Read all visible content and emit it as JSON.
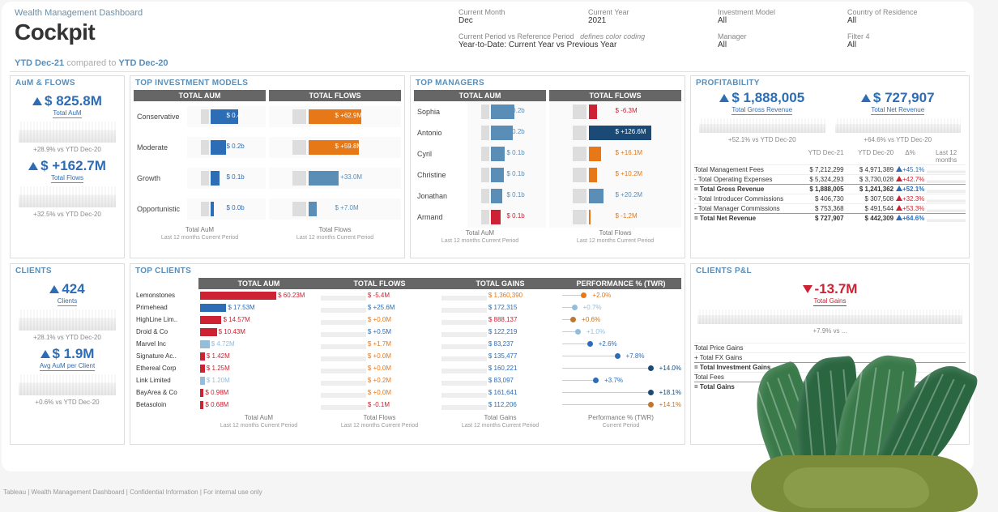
{
  "header": {
    "subtitle": "Wealth Management Dashboard",
    "title": "Cockpit"
  },
  "filters": {
    "month_lbl": "Current Month",
    "month": "Dec",
    "year_lbl": "Current Year",
    "year": "2021",
    "model_lbl": "Investment Model",
    "model": "All",
    "country_lbl": "Country of Residence",
    "country": "All",
    "period_lbl": "Current Period vs Reference Period",
    "period_note": "defines color coding",
    "period_val": "Year-to-Date: Current Year vs Previous Year",
    "manager_lbl": "Manager",
    "manager": "All",
    "filter4_lbl": "Filter 4",
    "filter4": "All"
  },
  "period_bar": {
    "p1": "YTD Dec-21",
    "mid": " compared to ",
    "p2": "YTD Dec-20"
  },
  "kpi_aum": {
    "hdr": "AuM & FLOWS",
    "total_aum": "$ 825.8M",
    "total_aum_lbl": "Total AuM",
    "aum_comp": "+28.9% vs YTD Dec-20",
    "flows": "$ +162.7M",
    "flows_lbl": "Total Flows",
    "flows_comp": "+32.5% vs YTD Dec-20"
  },
  "kpi_clients": {
    "hdr": "CLIENTS",
    "count": "424",
    "count_lbl": "Clients",
    "count_comp": "+28.1% vs YTD Dec-20",
    "avg": "$ 1.9M",
    "avg_lbl": "Avg AuM per Client",
    "avg_comp": "+0.6% vs YTD Dec-20"
  },
  "inv_models": {
    "hdr": "TOP INVESTMENT MODELS",
    "col1": "TOTAL AUM",
    "col2": "TOTAL FLOWS",
    "rows": [
      {
        "name": "Conservative",
        "aum": "$ 0.4b",
        "flow": "$ +62.9M",
        "aum_w": 70,
        "flow_w": 80,
        "fc": "#e67817"
      },
      {
        "name": "Moderate",
        "aum": "$ 0.2b",
        "flow": "$ +59.8M",
        "aum_w": 40,
        "flow_w": 76,
        "fc": "#e67817"
      },
      {
        "name": "Growth",
        "aum": "$ 0.1b",
        "flow": "$ +33.0M",
        "aum_w": 22,
        "flow_w": 45,
        "fc": "#5a8eb7"
      },
      {
        "name": "Opportunistic",
        "aum": "$ 0.0b",
        "flow": "$ +7.0M",
        "aum_w": 8,
        "flow_w": 12,
        "fc": "#5a8eb7"
      }
    ],
    "foot1": "Total AuM",
    "foot2": "Total Flows",
    "sub": "Last 12 months Current Period"
  },
  "managers": {
    "hdr": "TOP MANAGERS",
    "col1": "TOTAL AUM",
    "col2": "TOTAL FLOWS",
    "rows": [
      {
        "name": "Sophia",
        "aum": "$ 0.2b",
        "flow": "$ -6.3M",
        "aum_w": 60,
        "flow_w": -12,
        "fc": "#c23"
      },
      {
        "name": "Antonio",
        "aum": "$ 0.2b",
        "flow": "$ +126.6M",
        "aum_w": 55,
        "flow_w": 95,
        "fc": "#1a4a75"
      },
      {
        "name": "Cyril",
        "aum": "$ 0.1b",
        "flow": "$ +16.1M",
        "aum_w": 35,
        "flow_w": 18,
        "fc": "#e67817"
      },
      {
        "name": "Christine",
        "aum": "$ 0.1b",
        "flow": "$ +10.2M",
        "aum_w": 32,
        "flow_w": 12,
        "fc": "#e67817"
      },
      {
        "name": "Jonathan",
        "aum": "$ 0.1b",
        "flow": "$ +20.2M",
        "aum_w": 28,
        "flow_w": 22,
        "fc": "#5a8eb7"
      },
      {
        "name": "Armand",
        "aum": "$ 0.1b",
        "flow": "$ -1.2M",
        "aum_w": 25,
        "flow_w": -3,
        "fc": "#e67817",
        "ac": "#c23"
      }
    ],
    "foot1": "Total AuM",
    "foot2": "Total Flows",
    "sub": "Last 12 months   Current Period"
  },
  "profit": {
    "hdr": "PROFITABILITY",
    "gross": "$ 1,888,005",
    "gross_lbl": "Total Gross Revenue",
    "gross_comp": "+52.1% vs YTD Dec-20",
    "net": "$ 727,907",
    "net_lbl": "Total Net Revenue",
    "net_comp": "+64.6% vs YTD Dec-20",
    "th": {
      "c1": "",
      "c2": "YTD Dec-21",
      "c3": "YTD Dec-20",
      "c4": "Δ%",
      "c5": "Last 12 months"
    },
    "rows": [
      {
        "l": "  Total Management Fees",
        "v1": "$ 7,212,299",
        "v2": "$ 4,971,389",
        "d": "+45.1%",
        "dc": "blue"
      },
      {
        "l": "- Total Operating Expenses",
        "v1": "$ 5,324,293",
        "v2": "$ 3,730,028",
        "d": "+42.7%",
        "dc": "red"
      },
      {
        "l": "= Total Gross Revenue",
        "v1": "$ 1,888,005",
        "v2": "$ 1,241,362",
        "d": "+52.1%",
        "dc": "blue",
        "b": 1
      },
      {
        "l": "- Total Introducer Commissions",
        "v1": "$ 406,730",
        "v2": "$ 307,508",
        "d": "+32.3%",
        "dc": "red"
      },
      {
        "l": "- Total Manager Commissions",
        "v1": "$ 753,368",
        "v2": "$ 491,544",
        "d": "+53.3%",
        "dc": "red"
      },
      {
        "l": "= Total Net Revenue",
        "v1": "$ 727,907",
        "v2": "$ 442,309",
        "d": "+64.6%",
        "dc": "blue",
        "b": 1
      }
    ]
  },
  "clients": {
    "hdr": "TOP CLIENTS",
    "cols": {
      "c1": "TOTAL AUM",
      "c2": "TOTAL FLOWS",
      "c3": "TOTAL GAINS",
      "c4": "PERFORMANCE % (TWR)"
    },
    "rows": [
      {
        "n": "Lemonstones",
        "a": "$ 60.23M",
        "ac": "#c23",
        "aw": 64,
        "f": "$ -5.4M",
        "fc": "#c23",
        "g": "$ 1,360,390",
        "gc": "#e67817",
        "p": "+2.0%",
        "pc": "#e67817",
        "pp": 20
      },
      {
        "n": "Primehead",
        "a": "$ 17.53M",
        "ac": "#2d6db5",
        "aw": 22,
        "f": "$ +25.6M",
        "fc": "#2d6db5",
        "g": "$ 172,315",
        "gc": "#2d6db5",
        "p": "+0.7%",
        "pc": "#94bdd9",
        "pp": 12
      },
      {
        "n": "HighLine Lim..",
        "a": "$ 14.57M",
        "ac": "#c23",
        "aw": 18,
        "f": "$ +0.0M",
        "fc": "#e67817",
        "g": "$ 888,137",
        "gc": "#c23",
        "p": "+0.6%",
        "pc": "#b73",
        "pp": 11
      },
      {
        "n": "Droid & Co",
        "a": "$ 10.43M",
        "ac": "#c23",
        "aw": 14,
        "f": "$ +0.5M",
        "fc": "#2d6db5",
        "g": "$ 122,219",
        "gc": "#2d6db5",
        "p": "+1.0%",
        "pc": "#94bdd9",
        "pp": 15
      },
      {
        "n": "Marvel Inc",
        "a": "$ 4.72M",
        "ac": "#94bdd9",
        "aw": 8,
        "f": "$ +1.7M",
        "fc": "#e67817",
        "g": "$ 83,237",
        "gc": "#2d6db5",
        "p": "+2.6%",
        "pc": "#2d6db5",
        "pp": 25
      },
      {
        "n": "Signature Ac..",
        "a": "$ 1.42M",
        "ac": "#c23",
        "aw": 4,
        "f": "$ +0.0M",
        "fc": "#e67817",
        "g": "$ 135,477",
        "gc": "#2d6db5",
        "p": "+7.8%",
        "pc": "#2d6db5",
        "pp": 48
      },
      {
        "n": "Ethereal Corp",
        "a": "$ 1.25M",
        "ac": "#c23",
        "aw": 4,
        "f": "$ +0.0M",
        "fc": "#e67817",
        "g": "$ 160,221",
        "gc": "#2d6db5",
        "p": "+14.0%",
        "pc": "#1a4a75",
        "pp": 78
      },
      {
        "n": "Link Limited",
        "a": "$ 1.20M",
        "ac": "#94bdd9",
        "aw": 4,
        "f": "$ +0.2M",
        "fc": "#e67817",
        "g": "$ 83,097",
        "gc": "#2d6db5",
        "p": "+3.7%",
        "pc": "#2d6db5",
        "pp": 30
      },
      {
        "n": "BayArea & Co",
        "a": "$ 0.98M",
        "ac": "#c23",
        "aw": 3,
        "f": "$ +0.0M",
        "fc": "#e67817",
        "g": "$ 161,641",
        "gc": "#2d6db5",
        "p": "+18.1%",
        "pc": "#1a4a75",
        "pp": 88
      },
      {
        "n": "Betasoloin",
        "a": "$ 0.68M",
        "ac": "#c23",
        "aw": 3,
        "f": "$ -0.1M",
        "fc": "#c23",
        "g": "$ 112,206",
        "gc": "#2d6db5",
        "p": "+14.1%",
        "pc": "#b73",
        "pp": 79
      }
    ],
    "foots": {
      "f1": "Total AuM",
      "f2": "Total Flows",
      "f3": "Total Gains",
      "f4": "Performance % (TWR)"
    },
    "sub": "Last 12 months Current Period"
  },
  "pnl": {
    "hdr": "CLIENTS P&L",
    "gain": "-13.7M",
    "gain_lbl": "Total Gains",
    "gain_comp": "+7.9% vs ...",
    "rows": [
      {
        "l": "  Total Price Gains"
      },
      {
        "l": "+ Total FX Gains"
      },
      {
        "l": "= Total Investment Gains",
        "b": 1
      },
      {
        "l": "  Total Fees"
      },
      {
        "l": "= Total Gains",
        "b": 1
      }
    ]
  },
  "footer": "Tableau | Wealth Management Dashboard | Confidential Information | For internal use only",
  "chart_data": {
    "type": "table",
    "note": "Dashboard KPIs and tables captured above under inv_models, managers, profit, clients keys"
  }
}
